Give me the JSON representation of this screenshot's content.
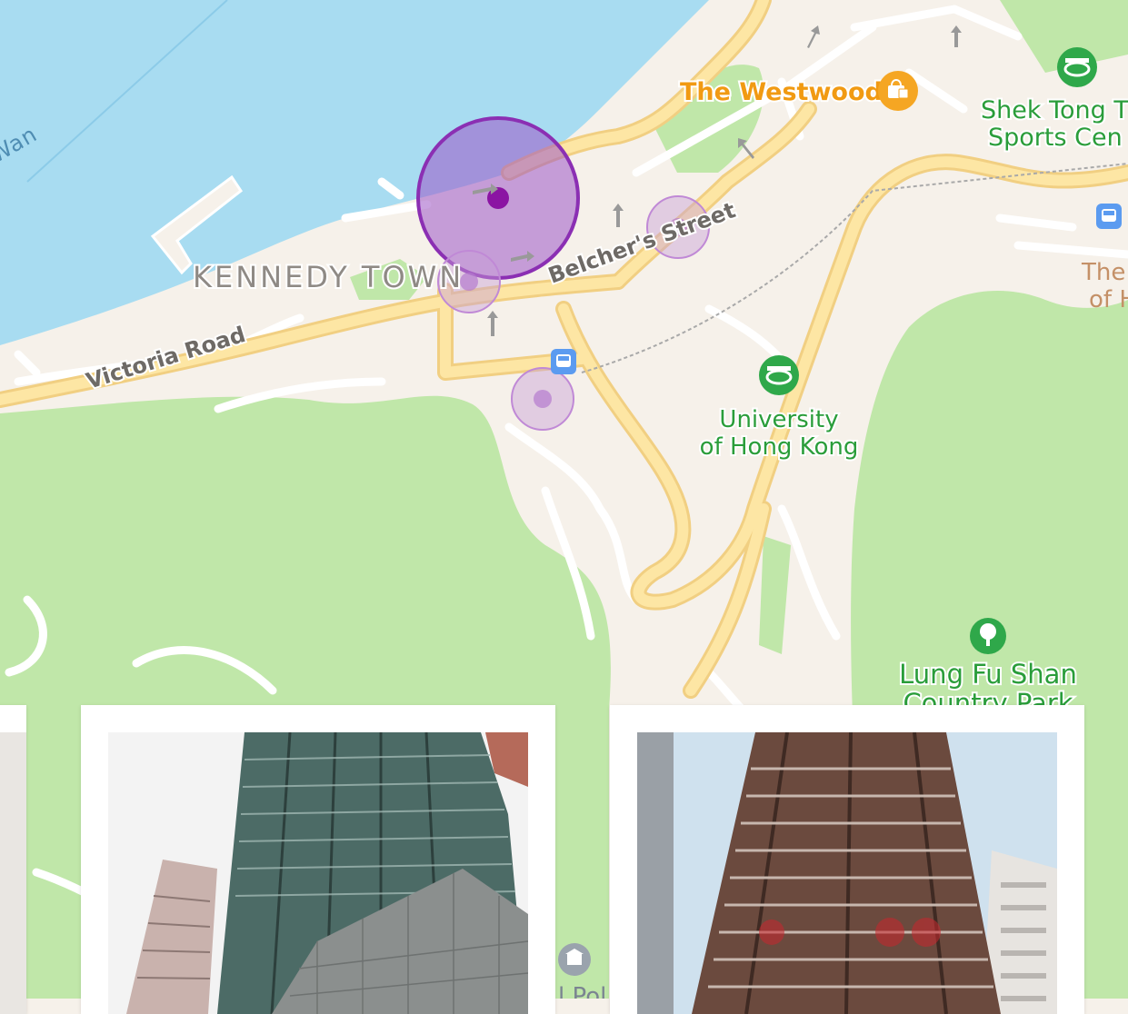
{
  "map": {
    "water_label": "Wan",
    "district_label": "KENNEDY TOWN",
    "streets": {
      "victoria_road": "Victoria Road",
      "belchers_street": "Belcher's Street"
    },
    "pois": {
      "westwood": "The Westwood",
      "shek_tong_line1": "Shek Tong T",
      "shek_tong_line2": "Sports Cen",
      "hku_line1": "University",
      "hku_line2": "of Hong Kong",
      "lung_fu_line1": "Lung Fu Shan",
      "lung_fu_line2": "Country Park",
      "right_edge_line1": "The",
      "right_edge_line2": "of H",
      "bottom_poi": "l Pol"
    },
    "icons": [
      "shopping-bag-icon",
      "stadium-icon",
      "train-icon",
      "tree-icon",
      "museum-icon"
    ],
    "colors": {
      "water": "#a8dcf1",
      "park": "#c0e7a9",
      "land": "#f6f1ea",
      "major_road": "#fde6a4",
      "poi_green": "#2a9d3a",
      "poi_orange": "#f19a12",
      "selected_marker": "#8b14a3",
      "cluster_marker": "#c89fd8",
      "transit": "#5b9bf0"
    }
  },
  "listings": {
    "cards": [
      {
        "id": "partial-left",
        "photo_desc": "building-photo"
      },
      {
        "id": "listing-1",
        "photo_desc": "glass-tower-photo"
      },
      {
        "id": "listing-2",
        "photo_desc": "brown-tower-photo"
      }
    ]
  }
}
